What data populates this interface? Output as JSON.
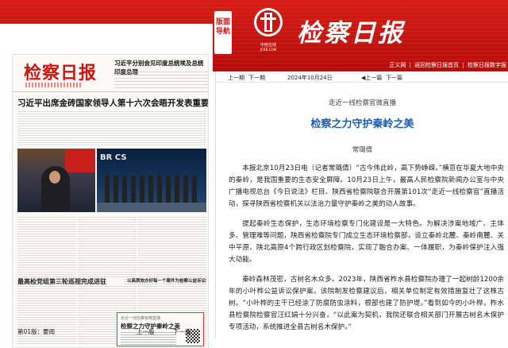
{
  "colors": {
    "brand_red": "#c81712",
    "title_blue": "#1a5fb4"
  },
  "banner": {
    "side_label_1": "版面",
    "side_label_2": "导航",
    "newspaper_title": "检察日报",
    "logo_caption": "中检在线",
    "logo_caption_en": "JCRB.COM",
    "nav_links": [
      "正义网",
      "返回检察日报首页",
      "检察日报数字报"
    ],
    "nav_separator": "|"
  },
  "front_page": {
    "masthead_title": "检察日报",
    "masthead_right_headline": "习近平分别会见印度总统埃及总统印度总理",
    "main_headline": "习近平出席金砖国家领导人第十六次会晤开发表重要讲话",
    "photo_badge": "BR CS",
    "column_headline_1": "最高检党组第三轮巡视完成进驻",
    "column_headline_2": "以高质效办好每一个案件为检察公益诉讼增添新动能",
    "box_tag": "走近一线检察官微直播",
    "box_title": "检察之力守护秦岭之美"
  },
  "page_footer": {
    "edition": "第01版：要闻",
    "prev": "上一版",
    "next": "下一版"
  },
  "date_bar": {
    "prev": "上一期",
    "next": "下一期",
    "date": "2024年10月24日",
    "article_prev": "上一篇",
    "article_next": "下一篇"
  },
  "article": {
    "kicker": "走近一线检察官微直播",
    "title": "检察之力守护秦岭之美",
    "author": "常璐倩",
    "paragraphs": [
      "本报北京10月23日电（记者常璐倩）“古今伟此岭，高下势峥嵘。”横亘在华夏大地中央的秦岭，是我国重要的生态安全屏障。10月23日上午，最高人民检察院新闻办公室与中央广播电视总台《今日说法》栏目、陕西省检察院联合开展第101次“走近一线检察官”直播活动，探寻陕西省检察机关以法治力量守护秦岭之美的动人故事。",
      "提起秦岭生态保护，生态环境检察专门化建设是一大特色。为解决涉案地域广、主体多、管理难等问题，陕西省检察院专门成立生态环境检察部，设立秦岭北麓、秦岭南麓、关中平原、陕北高原4个跨行政区划检察院，实现了融合办案、一体履职，为秦岭保护注入强大动能。",
      "秦岭森林茂密，古树名木众多。2023年，陕西省柞水县检察院办理了一起树龄1200余年的小叶桦公益诉讼保护案。该院制发检察建议后，相关单位制定有效措施复壮了这株古树。“小叶桦的主干已经涂了防腐防虫涂料，根部也建了防护堤。”看到如今的小叶桦，柞水县检察院检察官汪红娟十分兴奋，“以此案为契机，我院还联合相关部门开展古树名木保护专项活动，系统推进全县古树名木保护。”"
    ]
  }
}
